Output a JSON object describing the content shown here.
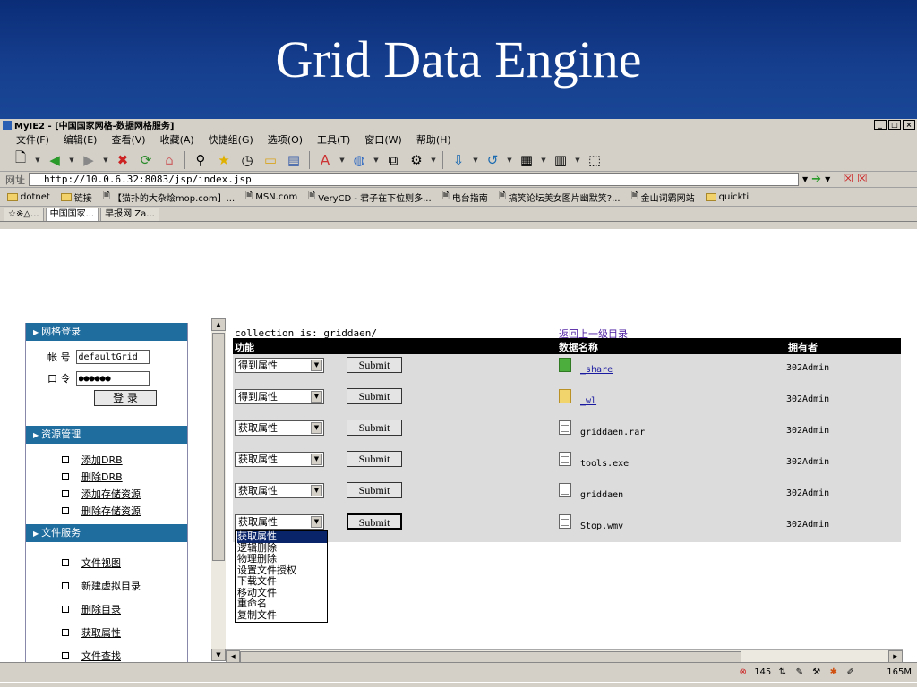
{
  "slide": {
    "title": "Grid Data Engine"
  },
  "window": {
    "title": "MyIE2 - [中国国家网格-数据网格服务]",
    "buttons": [
      "_",
      "□",
      "×"
    ]
  },
  "menu": [
    "文件(F)",
    "编辑(E)",
    "查看(V)",
    "收藏(A)",
    "快捷组(G)",
    "选项(O)",
    "工具(T)",
    "窗口(W)",
    "帮助(H)"
  ],
  "address": {
    "label": "网址",
    "url": "http://10.0.6.32:8083/jsp/index.jsp"
  },
  "links": [
    "dotnet",
    "链接",
    "【猫扑的大杂烩mop.com】...",
    "MSN.com",
    "VeryCD - 君子在下位则多...",
    "电台指南",
    "搞笑论坛美女图片幽默笑?...",
    "金山词霸网站",
    "quickti"
  ],
  "tabs": [
    "☆※△...",
    "中国国家...",
    "早报网 Za..."
  ],
  "sidebar": {
    "login_header": "网格登录",
    "account_label": "帐 号",
    "account_value": "defaultGrid",
    "password_label": "口 令",
    "password_value": "●●●●●●",
    "login_button": "登 录",
    "resource_header": "资源管理",
    "resource_items": [
      "添加DRB",
      "删除DRB",
      "添加存储资源",
      "删除存储资源"
    ],
    "file_header": "文件服务",
    "file_items": [
      "文件视图",
      "新建虚拟目录",
      "删除目录",
      "获取属性",
      "文件查找"
    ]
  },
  "main": {
    "collection_label": "collection is: griddaen/",
    "back_link": "返回上一级目录",
    "headers": {
      "func": "功能",
      "name": "数据名称",
      "owner": "拥有者"
    },
    "submit_label": "Submit",
    "rows": [
      {
        "select": "得到属性",
        "name": "_share",
        "owner": "302Admin"
      },
      {
        "select": "得到属性",
        "name": "_wl",
        "owner": "302Admin"
      },
      {
        "select": "获取属性",
        "name": "griddaen.rar",
        "owner": "302Admin"
      },
      {
        "select": "获取属性",
        "name": "tools.exe",
        "owner": "302Admin"
      },
      {
        "select": "获取属性",
        "name": "griddaen",
        "owner": "302Admin"
      },
      {
        "select": "获取属性",
        "name": "Stop.wmv",
        "owner": "302Admin"
      }
    ],
    "dropdown_options": [
      "获取属性",
      "逻辑删除",
      "物理删除",
      "设置文件授权",
      "下载文件",
      "移动文件",
      "重命名",
      "复制文件"
    ]
  },
  "status": {
    "count": "145",
    "memory": "165M"
  }
}
